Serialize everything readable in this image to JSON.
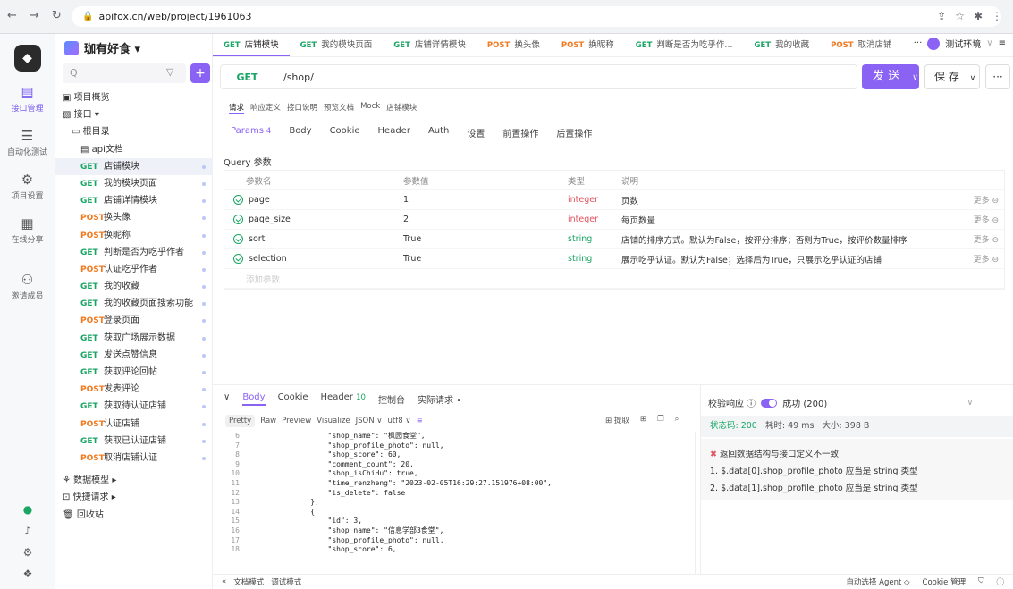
{
  "browser": {
    "url": "apifox.cn/web/project/1961063"
  },
  "rail": {
    "items": [
      {
        "label": "接口管理",
        "active": true
      },
      {
        "label": "自动化测试"
      },
      {
        "label": "项目设置"
      },
      {
        "label": "在线分享"
      },
      {
        "label": "邀请成员"
      }
    ]
  },
  "project": {
    "name": "珈有好食 ▾",
    "search_placeholder": "Q"
  },
  "tree": {
    "overview": "项目概览",
    "api": "接口 ▾",
    "root": "根目录",
    "doc": "api文档",
    "items": [
      {
        "m": "GET",
        "label": "店铺模块",
        "sel": true
      },
      {
        "m": "GET",
        "label": "我的模块页面"
      },
      {
        "m": "GET",
        "label": "店铺详情模块"
      },
      {
        "m": "POST",
        "label": "换头像"
      },
      {
        "m": "POST",
        "label": "换昵称"
      },
      {
        "m": "GET",
        "label": "判断是否为吃乎作者"
      },
      {
        "m": "POST",
        "label": "认证吃乎作者"
      },
      {
        "m": "GET",
        "label": "我的收藏"
      },
      {
        "m": "GET",
        "label": "我的收藏页面搜索功能"
      },
      {
        "m": "POST",
        "label": "登录页面"
      },
      {
        "m": "GET",
        "label": "获取广场展示数据"
      },
      {
        "m": "GET",
        "label": "发送点赞信息"
      },
      {
        "m": "GET",
        "label": "获取评论回帖"
      },
      {
        "m": "POST",
        "label": "发表评论"
      },
      {
        "m": "GET",
        "label": "获取待认证店铺"
      },
      {
        "m": "POST",
        "label": "认证店铺"
      },
      {
        "m": "GET",
        "label": "获取已认证店铺"
      },
      {
        "m": "POST",
        "label": "取消店铺认证"
      }
    ],
    "model": "数据模型 ▸",
    "quick": "快捷请求 ▸",
    "trash": "回收站"
  },
  "tabs": [
    {
      "m": "GET",
      "label": "店铺模块",
      "active": true
    },
    {
      "m": "GET",
      "label": "我的模块页面"
    },
    {
      "m": "GET",
      "label": "店铺详情模块"
    },
    {
      "m": "POST",
      "label": "换头像"
    },
    {
      "m": "POST",
      "label": "换昵称"
    },
    {
      "m": "GET",
      "label": "判断是否为吃乎作..."
    },
    {
      "m": "GET",
      "label": "我的收藏"
    },
    {
      "m": "POST",
      "label": "取消店铺"
    }
  ],
  "env": "测试环境",
  "request": {
    "method": "GET",
    "path": "/shop/",
    "send": "发 送",
    "save": "保 存"
  },
  "subtabs": [
    "请求",
    "响应定义",
    "接口说明",
    "预览文档",
    "Mock",
    "店铺模块"
  ],
  "paramtabs": [
    {
      "label": "Params",
      "count": "4",
      "active": true
    },
    {
      "label": "Body"
    },
    {
      "label": "Cookie"
    },
    {
      "label": "Header"
    },
    {
      "label": "Auth"
    },
    {
      "label": "设置"
    },
    {
      "label": "前置操作"
    },
    {
      "label": "后置操作"
    }
  ],
  "query_label": "Query 参数",
  "params_head": [
    "参数名",
    "参数值",
    "类型",
    "说明"
  ],
  "params": [
    {
      "name": "page",
      "value": "1",
      "type": "integer",
      "desc": "页数"
    },
    {
      "name": "page_size",
      "value": "2",
      "type": "integer",
      "desc": "每页数量"
    },
    {
      "name": "sort",
      "value": "True",
      "type": "string",
      "desc": "店铺的排序方式。默认为False，按评分排序；否则为True，按评价数量排序"
    },
    {
      "name": "selection",
      "value": "True",
      "type": "string",
      "desc": "展示吃乎认证。默认为False；选择后为True，只展示吃乎认证的店铺"
    }
  ],
  "more_label": "更多 ⊖",
  "add_param": "添加参数",
  "resp": {
    "tabs": {
      "body": "Body",
      "cookie": "Cookie",
      "header": "Header",
      "header_count": "10",
      "console": "控制台",
      "actual": "实际请求 •"
    },
    "tools": [
      "Pretty",
      "Raw",
      "Preview",
      "Visualize",
      "JSON ∨",
      "utf8 ∨"
    ],
    "extract": "⊞ 提取",
    "code": [
      {
        "n": "6",
        "t": "        \"shop_name\": \"枫园食堂\","
      },
      {
        "n": "7",
        "t": "        \"shop_profile_photo\": null,"
      },
      {
        "n": "8",
        "t": "        \"shop_score\": 60,"
      },
      {
        "n": "9",
        "t": "        \"comment_count\": 20,"
      },
      {
        "n": "10",
        "t": "        \"shop_isChiHu\": true,"
      },
      {
        "n": "11",
        "t": "        \"time_renzheng\": \"2023-02-05T16:29:27.151976+08:00\","
      },
      {
        "n": "12",
        "t": "        \"is_delete\": false"
      },
      {
        "n": "13",
        "t": "    },"
      },
      {
        "n": "14",
        "t": "    {"
      },
      {
        "n": "15",
        "t": "        \"id\": 3,"
      },
      {
        "n": "16",
        "t": "        \"shop_name\": \"信息学部3食堂\","
      },
      {
        "n": "17",
        "t": "        \"shop_profile_photo\": null,"
      },
      {
        "n": "18",
        "t": "        \"shop_score\": 6,"
      }
    ]
  },
  "validation": {
    "label": "校验响应 ⓘ",
    "result": "成功 (200)",
    "status": "状态码: 200",
    "time": "耗时: 49 ms",
    "size": "大小: 398 B",
    "error": "返回数据结构与接口定义不一致",
    "issues": [
      "1. $.data[0].shop_profile_photo 应当是 string 类型",
      "2. $.data[1].shop_profile_photo 应当是 string 类型"
    ]
  },
  "footer": {
    "left": [
      "文档模式",
      "调试模式"
    ],
    "right": [
      "自动选择 Agent ◇",
      "Cookie 管理"
    ]
  }
}
